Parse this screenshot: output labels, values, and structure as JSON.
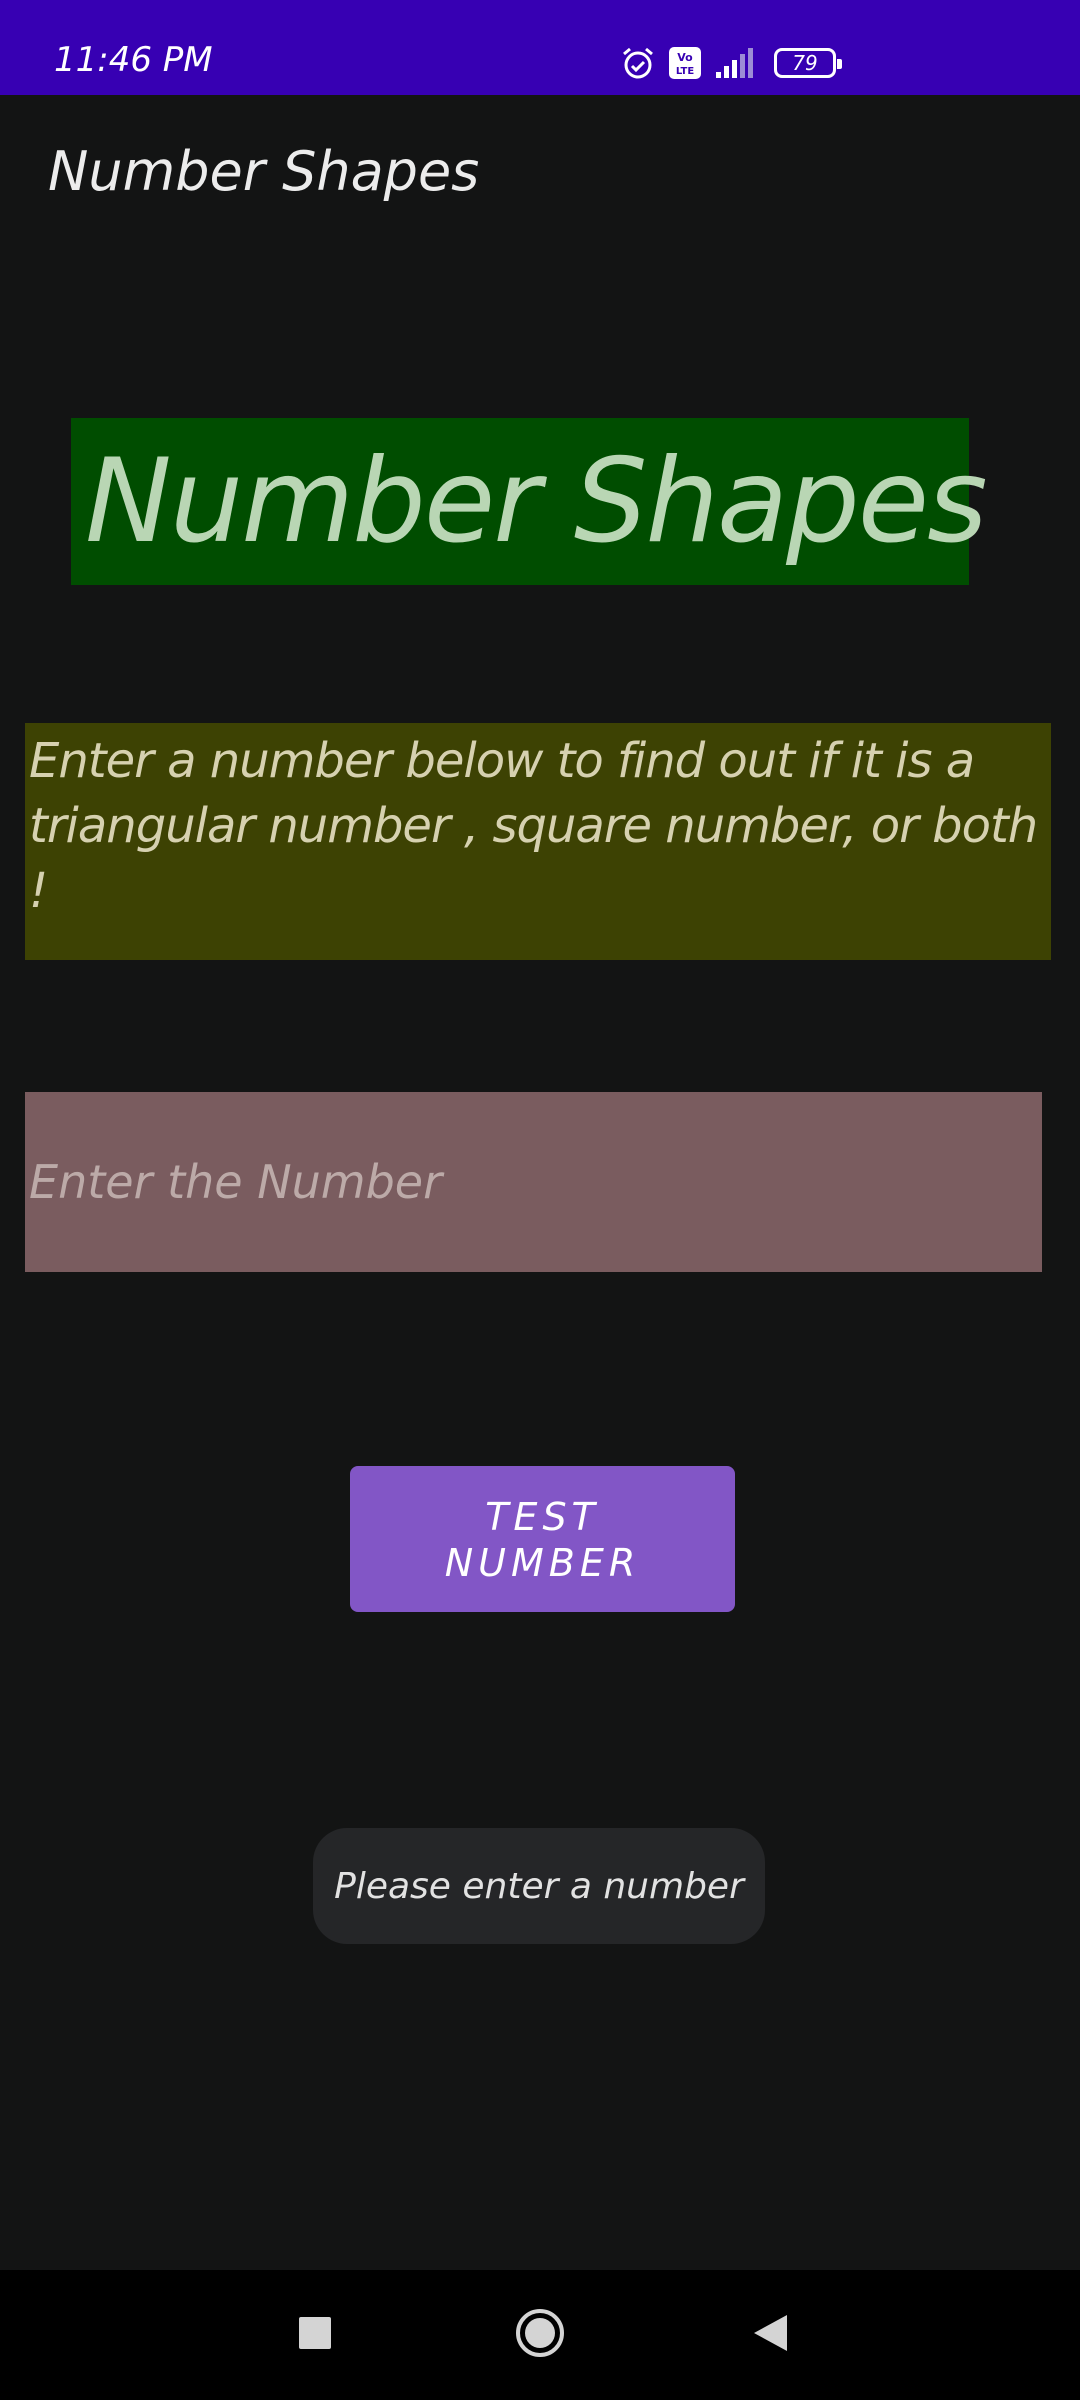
{
  "status_bar": {
    "time": "11:46 PM",
    "battery": "79",
    "icons": [
      "alarm-icon",
      "volte-icon",
      "signal-icon",
      "battery-icon"
    ],
    "color": "#3700b3"
  },
  "app_bar": {
    "title": "Number Shapes"
  },
  "main": {
    "heading": "Number Shapes",
    "description": "Enter a number below to find out if it is a triangular number , square number, or both !",
    "input": {
      "placeholder": "Enter the Number",
      "value": ""
    },
    "button_label": "TEST NUMBER"
  },
  "toast": {
    "message": "Please enter a number"
  },
  "nav_bar": {
    "icons": [
      "recents-square-icon",
      "home-circle-icon",
      "back-triangle-icon"
    ]
  },
  "colors": {
    "background": "#131414",
    "heading_bg": "#004d00",
    "description_bg": "#3d4203",
    "input_bg": "#7a5c5f",
    "button_bg": "#8256c6",
    "toast_bg": "#252628"
  }
}
